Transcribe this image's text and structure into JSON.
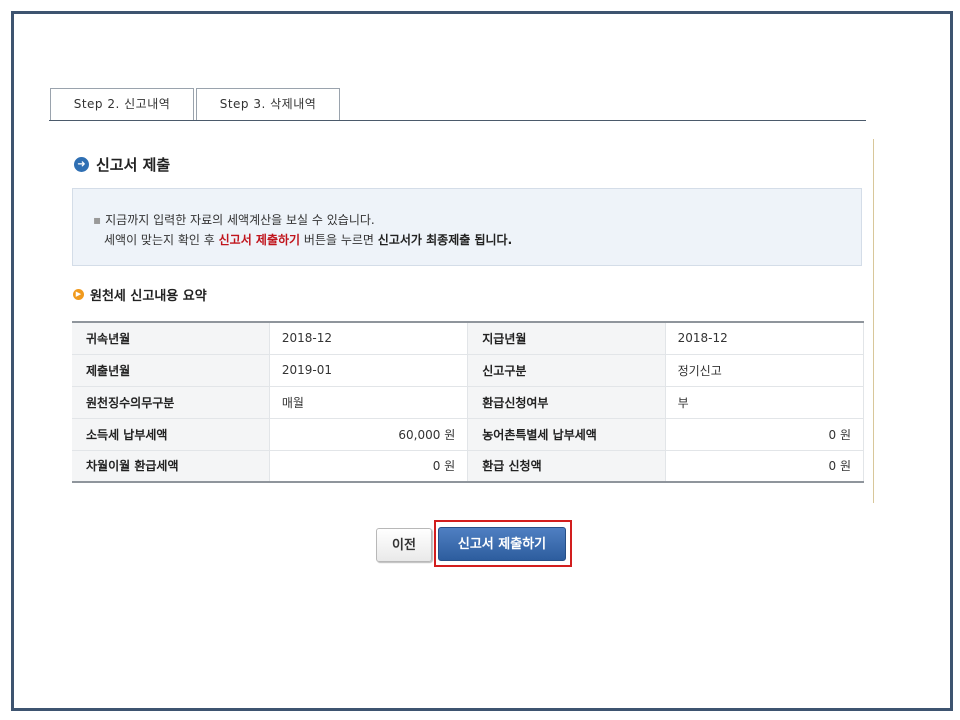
{
  "tabs": [
    {
      "label": "Step 2. 신고내역"
    },
    {
      "label": "Step 3. 삭제내역"
    }
  ],
  "section": {
    "title": "신고서 제출"
  },
  "notice": {
    "line1": "지금까지 입력한 자료의 세액계산을 보실 수 있습니다.",
    "line2_pre": "세액이 맞는지 확인 후 ",
    "line2_red": "신고서 제출하기",
    "line2_mid": " 버튼을 누르면 ",
    "line2_bold": "신고서가 최종제출 됩니다."
  },
  "summary": {
    "title": "원천세 신고내용 요약",
    "rows": [
      {
        "l1": "귀속년월",
        "v1": "2018-12",
        "l2": "지급년월",
        "v2": "2018-12"
      },
      {
        "l1": "제출년월",
        "v1": "2019-01",
        "l2": "신고구분",
        "v2": "정기신고"
      },
      {
        "l1": "원천징수의무구분",
        "v1": "매월",
        "l2": "환급신청여부",
        "v2": "부"
      },
      {
        "l1": "소득세 납부세액",
        "v1": "60,000 원",
        "l2": "농어촌특별세 납부세액",
        "v2": "0 원"
      },
      {
        "l1": "차월이월 환급세액",
        "v1": "0 원",
        "l2": "환급 신청액",
        "v2": "0 원"
      }
    ]
  },
  "buttons": {
    "prev": "이전",
    "submit": "신고서 제출하기"
  },
  "colors": {
    "frame": "#3e5470",
    "submit_button": "#2d5d9e",
    "highlight": "#d21e1e",
    "accent_red": "#c0141c"
  }
}
